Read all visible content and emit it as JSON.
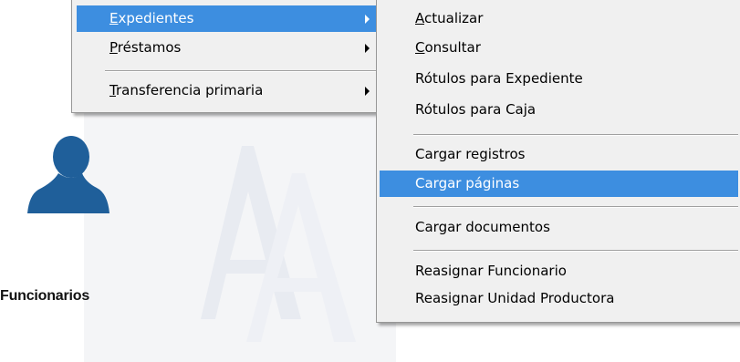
{
  "desktop": {
    "user_caption": "Funcionarios",
    "icons": {
      "user": "user-silhouette-icon",
      "watermark": "aa-logo-watermark"
    }
  },
  "colors": {
    "highlight": "#3d8ee0",
    "menu_bg": "#f0f0f0",
    "user_icon": "#1f5f9a"
  },
  "main_menu": {
    "items": [
      {
        "accel": "E",
        "rest": "xpedientes",
        "has_submenu": true,
        "highlighted": true
      },
      {
        "accel": "P",
        "rest": "réstamos",
        "has_submenu": true,
        "highlighted": false
      },
      {
        "accel": "T",
        "rest": "ransferencia primaria",
        "has_submenu": true,
        "highlighted": false
      }
    ]
  },
  "sub_menu": {
    "items": [
      {
        "accel": "A",
        "rest": "ctualizar",
        "highlighted": false
      },
      {
        "accel": "C",
        "rest": "onsultar",
        "highlighted": false
      },
      {
        "accel": "",
        "rest": "Rótulos para Expediente",
        "highlighted": false
      },
      {
        "accel": "",
        "rest": "Rótulos para Caja",
        "highlighted": false
      },
      {
        "accel": "",
        "rest": "Cargar registros",
        "highlighted": false
      },
      {
        "accel": "",
        "rest": "Cargar páginas",
        "highlighted": true
      },
      {
        "accel": "",
        "rest": "Cargar documentos",
        "highlighted": false
      },
      {
        "accel": "",
        "rest": "Reasignar Funcionario",
        "highlighted": false
      },
      {
        "accel": "",
        "rest": "Reasignar Unidad Productora",
        "highlighted": false
      }
    ]
  }
}
